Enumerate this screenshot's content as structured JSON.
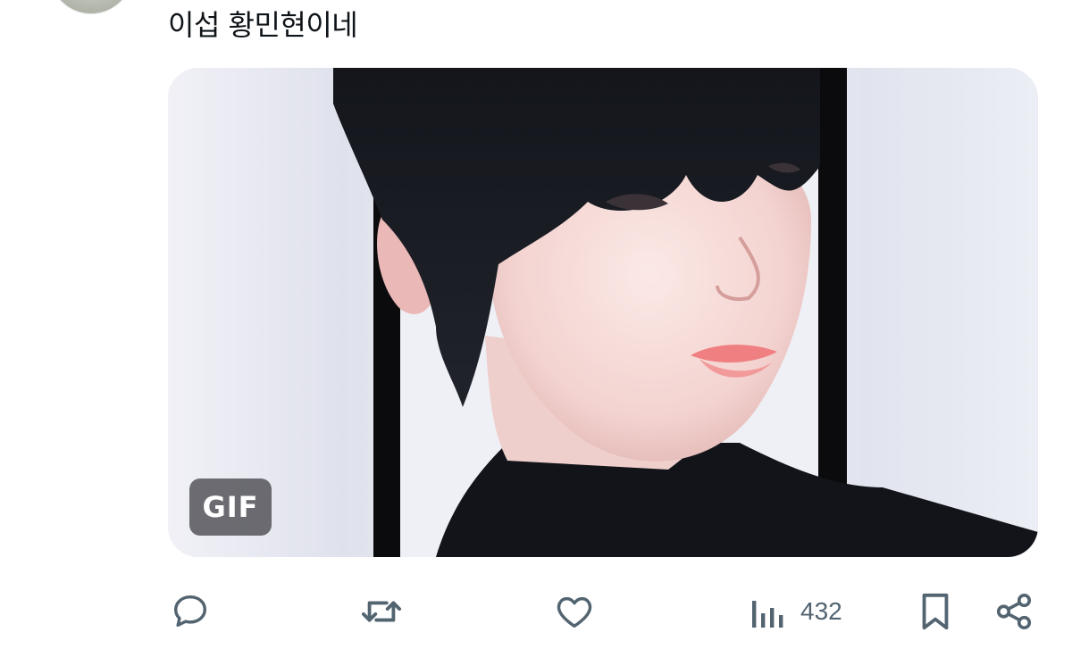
{
  "post": {
    "text": "이섭 황민현이네"
  },
  "media": {
    "badge": "GIF"
  },
  "actions": {
    "reply_icon": "reply-bubble-icon",
    "repost_icon": "repost-arrows-icon",
    "like_icon": "heart-icon",
    "views_icon": "views-bar-chart-icon",
    "views_count": "432",
    "bookmark_icon": "bookmark-icon",
    "share_icon": "share-icon"
  },
  "colors": {
    "text": "#0f1419",
    "icon": "#536471",
    "badge_bg": "#46464c"
  }
}
